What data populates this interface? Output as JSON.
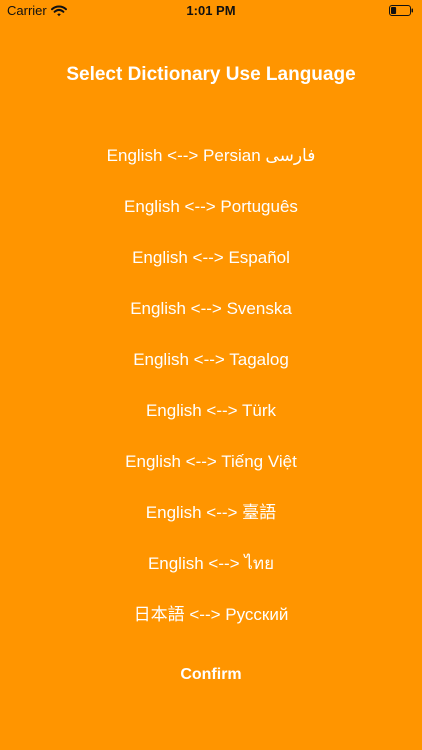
{
  "status_bar": {
    "carrier": "Carrier",
    "time": "1:01 PM",
    "icons": [
      "wifi-icon",
      "battery-icon"
    ],
    "battery_level": 0.3
  },
  "screen": {
    "title": "Select Dictionary Use Language",
    "background_color": "#FF9500",
    "text_color": "#FFFFFF"
  },
  "languages": [
    "English <--> Persian فارسی",
    "English <--> Português",
    "English <--> Español",
    "English <--> Svenska",
    "English <--> Tagalog",
    "English <--> Türk",
    "English <--> Tiếng Việt",
    "English <--> 臺語",
    "English <--> ไทย",
    "日本語 <--> Русский"
  ],
  "actions": {
    "confirm_label": "Confirm"
  }
}
